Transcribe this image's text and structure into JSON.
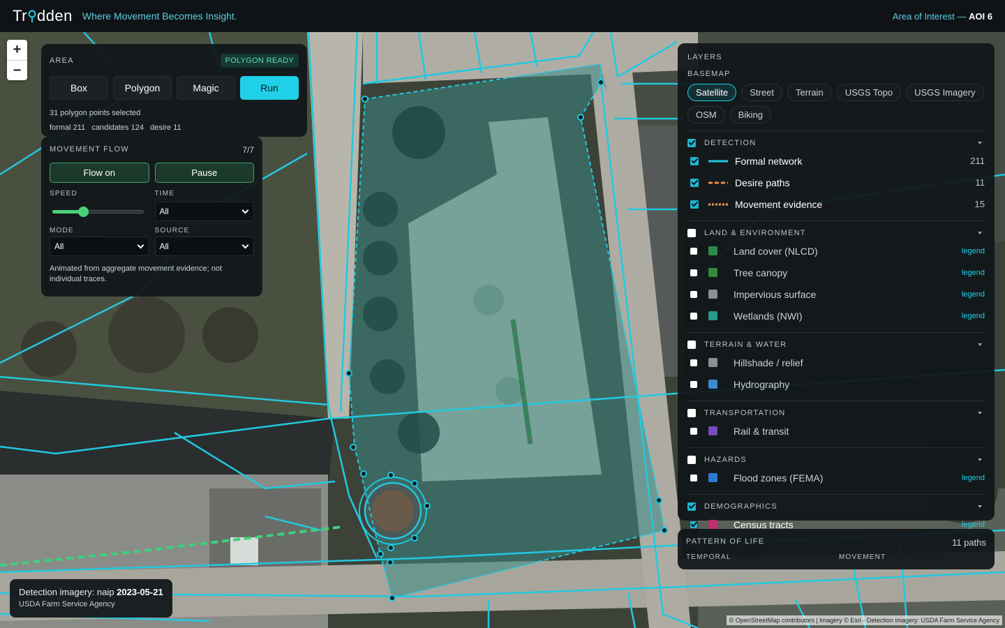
{
  "header": {
    "brand": "Trodden",
    "brand_left": "Tr",
    "brand_right": "dden",
    "tagline": "Where Movement Becomes Insight.",
    "aoi_prefix": "Area of Interest —",
    "aoi_value": "AOI 6"
  },
  "zoom": {
    "in": "+",
    "out": "−"
  },
  "area": {
    "title": "AREA",
    "status": "POLYGON READY",
    "buttons": [
      "Box",
      "Polygon",
      "Magic",
      "Run"
    ],
    "selection": "31 polygon points selected",
    "stats": [
      {
        "label": "formal",
        "value": "211"
      },
      {
        "label": "candidates",
        "value": "124"
      },
      {
        "label": "desire",
        "value": "11"
      }
    ]
  },
  "flow": {
    "title": "MOVEMENT FLOW",
    "count": "7/7",
    "flow_on": "Flow on",
    "pause": "Pause",
    "speed_label": "SPEED",
    "speed_value": 0.3,
    "time_label": "TIME",
    "time_value": "All",
    "mode_label": "MODE",
    "mode_value": "All",
    "source_label": "SOURCE",
    "source_value": "All",
    "note": "Animated from aggregate movement evidence; not individual traces."
  },
  "layers": {
    "title": "LAYERS",
    "basemap_label": "BASEMAP",
    "basemaps": [
      "Satellite",
      "Street",
      "Terrain",
      "USGS Topo",
      "USGS Imagery",
      "OSM",
      "Biking"
    ],
    "active_basemap": "Satellite",
    "detection": {
      "label": "DETECTION",
      "checked": true,
      "items": [
        {
          "name": "Formal network",
          "count": "211",
          "checked": true,
          "color": "#22c8e0",
          "style": "solid"
        },
        {
          "name": "Desire paths",
          "count": "11",
          "checked": true,
          "color": "#f08a3c",
          "style": "dashed"
        },
        {
          "name": "Movement evidence",
          "count": "15",
          "checked": true,
          "color": "#f0a050",
          "style": "dotted"
        }
      ]
    },
    "land": {
      "label": "LAND & ENVIRONMENT",
      "checked": false,
      "items": [
        {
          "name": "Land cover (NLCD)",
          "legend": "legend",
          "color": "#2f8a4a"
        },
        {
          "name": "Tree canopy",
          "legend": "legend",
          "color": "#2f8a3a"
        },
        {
          "name": "Impervious surface",
          "legend": "legend",
          "color": "#8a8f92"
        },
        {
          "name": "Wetlands (NWI)",
          "legend": "legend",
          "color": "#2a9a8a"
        }
      ]
    },
    "terrain": {
      "label": "TERRAIN & WATER",
      "checked": false,
      "items": [
        {
          "name": "Hillshade / relief",
          "color": "#8a8f92"
        },
        {
          "name": "Hydrography",
          "color": "#3a8ad0"
        }
      ]
    },
    "transport": {
      "label": "TRANSPORTATION",
      "checked": false,
      "items": [
        {
          "name": "Rail & transit",
          "color": "#7a4ac0"
        }
      ]
    },
    "hazards": {
      "label": "HAZARDS",
      "checked": false,
      "items": [
        {
          "name": "Flood zones (FEMA)",
          "legend": "legend",
          "color": "#2a7ad0"
        }
      ]
    },
    "demographics": {
      "label": "DEMOGRAPHICS",
      "checked": true,
      "items": [
        {
          "name": "Census tracts",
          "legend": "legend",
          "color": "#c0306a",
          "checked": true
        }
      ]
    }
  },
  "pattern": {
    "title": "PATTERN OF LIFE",
    "paths": "11 paths",
    "temporal": "TEMPORAL",
    "movement": "MOVEMENT"
  },
  "detection_imagery": {
    "prefix": "Detection imagery: naip",
    "date": "2023-05-21",
    "agency": "USDA Farm Service Agency"
  },
  "attribution": "© OpenStreetMap contributors | Imagery © Esri - Detection imagery: USDA Farm Service Agency",
  "colors": {
    "accent": "#1fd0e8",
    "formal_network": "#22c8e0",
    "desire_path": "#3ed07a",
    "polygon_fill": "#3a8a88"
  }
}
